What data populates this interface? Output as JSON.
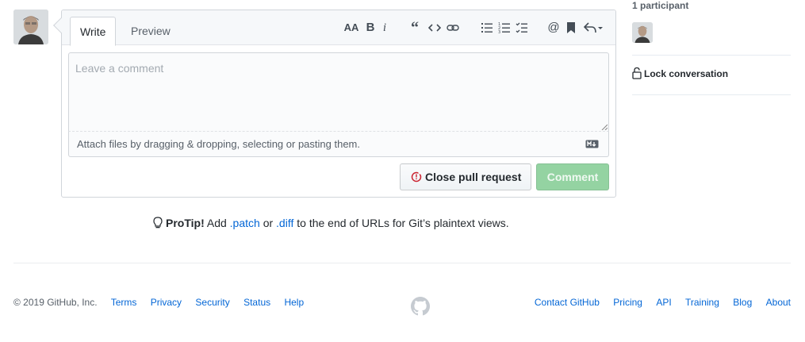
{
  "composer": {
    "tabs": [
      {
        "label": "Write",
        "active": true
      },
      {
        "label": "Preview",
        "active": false
      }
    ],
    "toolbar_icons": [
      "text-size-icon",
      "bold-icon",
      "italic-icon",
      "quote-icon",
      "code-icon",
      "link-icon",
      "unordered-list-icon",
      "ordered-list-icon",
      "task-list-icon",
      "mention-icon",
      "saved-reply-icon",
      "reply-icon"
    ],
    "textarea": {
      "placeholder": "Leave a comment",
      "value": ""
    },
    "attach_text": "Attach files by dragging & dropping, selecting or pasting them.",
    "close_label": "Close pull request",
    "comment_label": "Comment"
  },
  "protip": {
    "prefix": "ProTip!",
    "text_add": " Add ",
    "patch": ".patch",
    "or": " or ",
    "diff": ".diff",
    "rest": " to the end of URLs for Git’s plaintext views."
  },
  "sidebar": {
    "participants_title": "1 participant",
    "lock_label": "Lock conversation"
  },
  "footer": {
    "copyright": "© 2019 GitHub, Inc.",
    "left_links": [
      "Terms",
      "Privacy",
      "Security",
      "Status",
      "Help"
    ],
    "right_links": [
      "Contact GitHub",
      "Pricing",
      "API",
      "Training",
      "Blog",
      "About"
    ]
  },
  "colors": {
    "link": "#0366d6",
    "comment_button": "#94d3a2",
    "close_icon": "#cb2431"
  }
}
